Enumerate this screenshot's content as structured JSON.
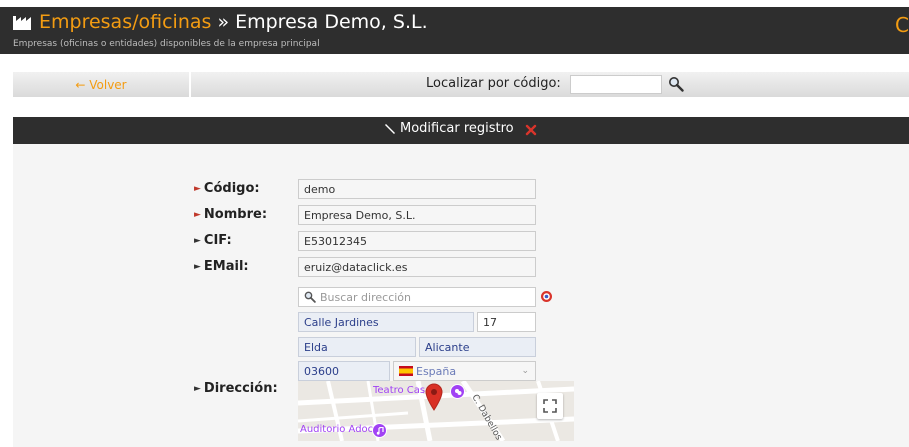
{
  "header": {
    "title_accent": "Empresas/oficinas",
    "title_rest": " » Empresa Demo, S.L.",
    "subtitle": "Empresas (oficinas o entidades) disponibles de la empresa principal",
    "right_glyph": "C"
  },
  "toolbar": {
    "back_label": "← Volver",
    "locate_label": "Localizar por código:",
    "locate_value": ""
  },
  "panel": {
    "title": "Modificar registro"
  },
  "form": {
    "codigo": {
      "label": "Código:",
      "value": "demo"
    },
    "nombre": {
      "label": "Nombre:",
      "value": "Empresa Demo, S.L."
    },
    "cif": {
      "label": "CIF:",
      "value": "E53012345"
    },
    "email": {
      "label": "EMail:",
      "value": "eruiz@dataclick.es"
    },
    "direccion": {
      "label": "Dirección:",
      "search_placeholder": "Buscar dirección",
      "street": "Calle Jardines",
      "number": "17",
      "city": "Elda",
      "province": "Alicante",
      "postal_code": "03600",
      "country": "España"
    }
  },
  "map": {
    "labels": [
      "Teatro Cas",
      "Auditorio Adoc",
      "C. Dabellos"
    ]
  },
  "colors": {
    "accent": "#f39c12",
    "dark_bar": "#2e2e2e",
    "required_arrow": "#c0392b",
    "field_blue_text": "#2b3e8a",
    "map_pin": "#d93025",
    "poi_purple": "#a142f4"
  }
}
